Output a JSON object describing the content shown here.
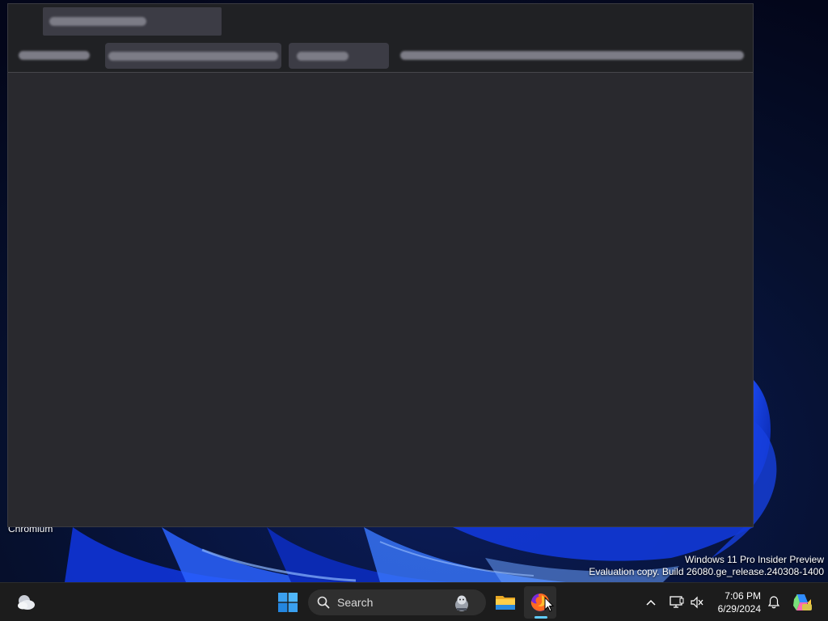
{
  "desktop": {
    "icon_label": "Chromium"
  },
  "watermark": {
    "line1": "Windows 11 Pro Insider Preview",
    "line2": "Evaluation copy. Build 26080.ge_release.240308-1400"
  },
  "taskbar": {
    "search_label": "Search",
    "clock_time": "7:06 PM",
    "clock_date": "6/29/2024",
    "icons": [
      "weather-icon",
      "start-icon",
      "search-icon",
      "search-highlight-icon",
      "file-explorer-icon",
      "firefox-icon",
      "tray-overflow-icon",
      "network-icon",
      "volume-muted-icon",
      "notification-bell-icon",
      "copilot-icon"
    ]
  },
  "colors": {
    "accent": "#60cdff",
    "window_bg": "#29292e",
    "taskbar_bg": "#1c1c1c"
  }
}
